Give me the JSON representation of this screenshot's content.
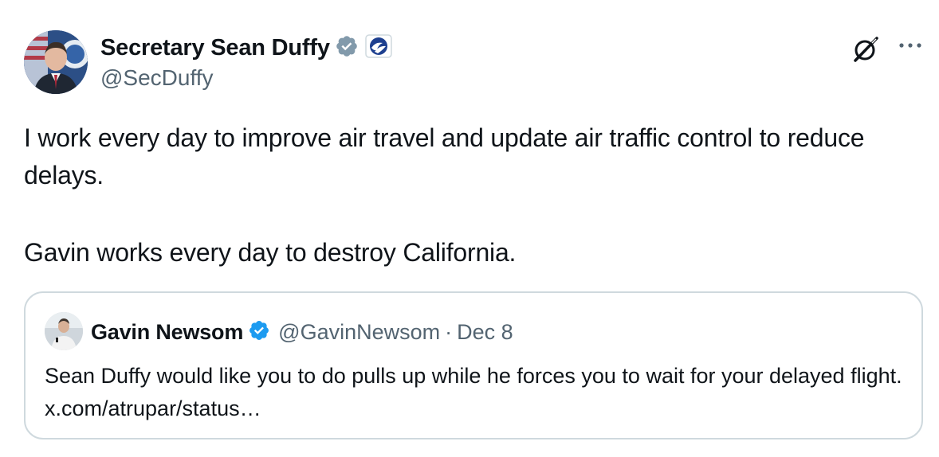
{
  "tweet": {
    "author": {
      "display_name": "Secretary Sean Duffy",
      "handle": "@SecDuffy",
      "verified_badge_icon": "verified-badge-gray-icon",
      "affiliation_icon": "dot-logo-icon"
    },
    "text_lines": [
      "I work every day to improve air travel and update air traffic control to reduce delays.",
      "Gavin works every day to destroy California."
    ],
    "actions": {
      "grok_icon": "grok-icon",
      "more_icon": "more-horizontal-icon"
    }
  },
  "quote": {
    "author": {
      "display_name": "Gavin Newsom",
      "handle": "@GavinNewsom",
      "verified_badge_icon": "verified-badge-blue-icon"
    },
    "separator": "·",
    "date": "Dec 8",
    "text": "Sean Duffy would like you to do pulls up while he forces you to wait for your delayed flight. x.com/atrupar/status…"
  },
  "colors": {
    "text_primary": "#0f1419",
    "text_secondary": "#536471",
    "border": "#cfd9de",
    "verified_blue": "#1d9bf0",
    "verified_gray": "#829aab"
  }
}
